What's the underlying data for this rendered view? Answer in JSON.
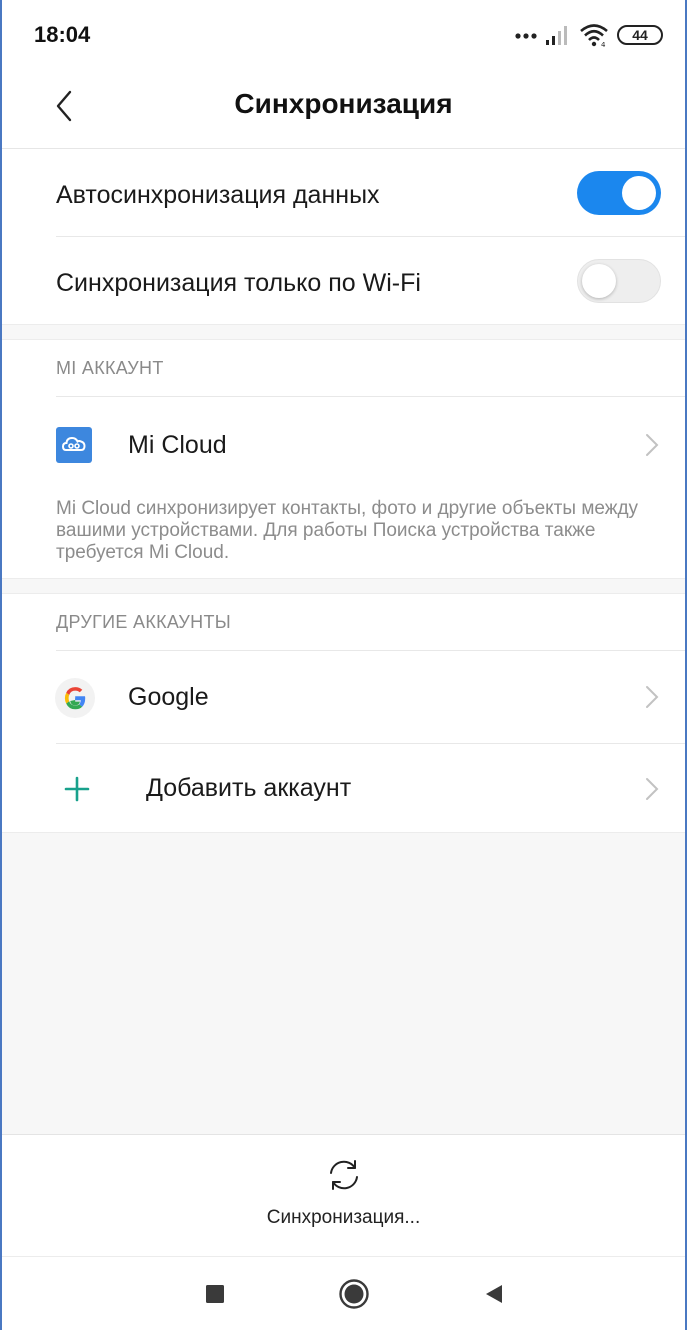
{
  "status_bar": {
    "time": "18:04",
    "battery": "44",
    "icons": [
      "dots-icon",
      "signal-icon",
      "wifi-icon",
      "battery-icon"
    ]
  },
  "header": {
    "title": "Синхронизация",
    "back_icon": "chevron-left-icon"
  },
  "settings": {
    "auto_sync": {
      "label": "Автосинхронизация данных",
      "enabled": true
    },
    "wifi_only": {
      "label": "Синхронизация только по Wi-Fi",
      "enabled": false
    }
  },
  "mi_account": {
    "header": "MI АККАУНТ",
    "item": {
      "label": "Mi Cloud",
      "icon": "mi-cloud-icon"
    },
    "note": "Mi Cloud синхронизирует контакты, фото и другие объекты между вашими устройствами. Для работы Поиска устройства также требуется Mi Cloud."
  },
  "other_accounts": {
    "header": "ДРУГИЕ АККАУНТЫ",
    "items": [
      {
        "label": "Google",
        "icon": "google-icon"
      },
      {
        "label": "Добавить аккаунт",
        "icon": "plus-icon"
      }
    ]
  },
  "sync": {
    "label": "Синхронизация...",
    "icon": "sync-icon"
  },
  "nav": {
    "buttons": [
      "recents-icon",
      "home-icon",
      "back-icon"
    ]
  },
  "colors": {
    "accent": "#1b87ee",
    "mi_cloud": "#3d87de",
    "plus": "#18a18c",
    "section_bg": "#f7f7f7"
  }
}
